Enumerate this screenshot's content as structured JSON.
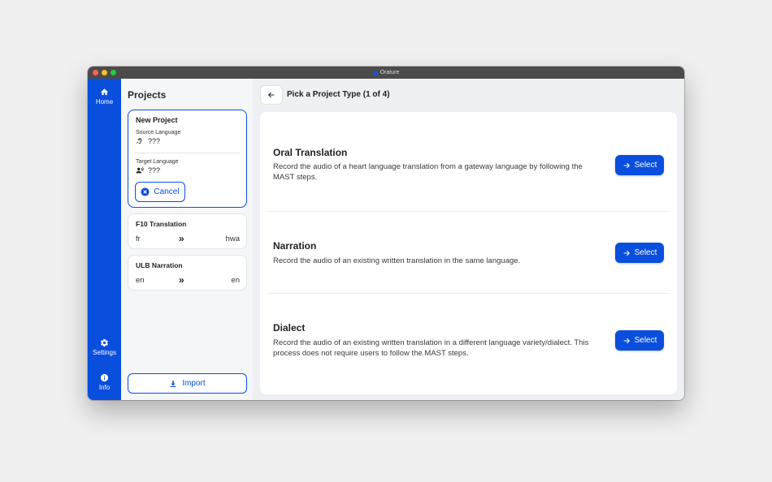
{
  "window": {
    "title": "Orature"
  },
  "nav": {
    "home_label": "Home",
    "settings_label": "Settings",
    "info_label": "Info",
    "accent_color": "#0a4ede"
  },
  "projects_panel": {
    "title": "Projects",
    "new_project": {
      "title": "New Project",
      "source_label": "Source Language",
      "source_value": "???",
      "target_label": "Target Language",
      "target_value": "???",
      "cancel_label": "Cancel"
    },
    "projects": [
      {
        "title": "F10 Translation",
        "source": "fr",
        "arrow": "»",
        "target": "hwa"
      },
      {
        "title": "ULB Narration",
        "source": "en",
        "arrow": "»",
        "target": "en"
      }
    ],
    "import_label": "Import"
  },
  "main": {
    "title": "Pick a Project Type (1 of 4)",
    "types": [
      {
        "name": "Oral Translation",
        "description": "Record the audio of a heart language translation from a gateway language by following the MAST steps.",
        "button": "Select"
      },
      {
        "name": "Narration",
        "description": "Record the audio of an existing written translation in the same language.",
        "button": "Select"
      },
      {
        "name": "Dialect",
        "description": "Record the audio of an existing written translation in a different language variety/dialect. This process does not require users to follow the MAST steps.",
        "button": "Select"
      }
    ]
  }
}
